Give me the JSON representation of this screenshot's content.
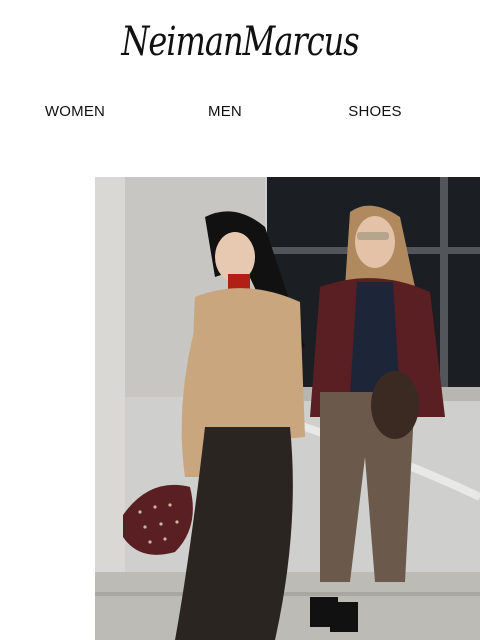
{
  "brand": {
    "logo_text": "NeimanMarcus"
  },
  "nav": {
    "items": [
      {
        "label": "WOMEN"
      },
      {
        "label": "MEN"
      },
      {
        "label": "SHOES"
      }
    ]
  },
  "hero": {
    "image_name": "hero-image",
    "colors": {
      "wall": "#cfcfcd",
      "window": "#1b1e22",
      "camel_jacket": "#c9a67e",
      "leather_skirt": "#2b2522",
      "burgundy": "#5a1f22",
      "trousers": "#6b5a4b",
      "navy_sweater": "#1d2638"
    }
  }
}
